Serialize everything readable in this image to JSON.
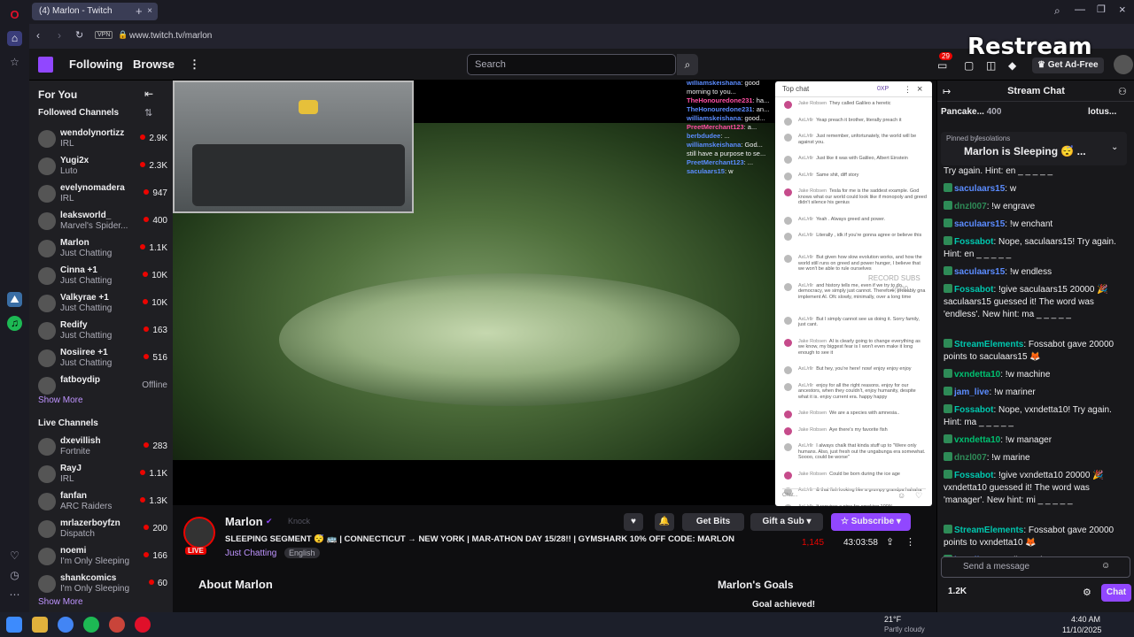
{
  "browser": {
    "tab_title": "(4) Marlon - Twitch",
    "url": "www.twitch.tv/marlon",
    "vpn_label": "VPN"
  },
  "restream_watermark": "Restream",
  "twitch_nav": {
    "following": "Following",
    "browse": "Browse",
    "search_placeholder": "Search",
    "notifications_count": "29",
    "get_ad_free": "Get Ad-Free"
  },
  "sidebar": {
    "for_you": "For You",
    "followed_title": "Followed Channels",
    "followed": [
      {
        "name": "wendolynortizz",
        "category": "IRL",
        "viewers": "2.9K"
      },
      {
        "name": "Yugi2x",
        "category": "Luto",
        "viewers": "2.3K"
      },
      {
        "name": "evelynomadera",
        "category": "IRL",
        "viewers": "947"
      },
      {
        "name": "leaksworld_",
        "category": "Marvel's Spider...",
        "viewers": "400"
      },
      {
        "name": "Marlon",
        "category": "Just Chatting",
        "viewers": "1.1K"
      },
      {
        "name": "Cinna +1",
        "category": "Just Chatting",
        "viewers": "10K"
      },
      {
        "name": "Valkyrae +1",
        "category": "Just Chatting",
        "viewers": "10K"
      },
      {
        "name": "Redify",
        "category": "Just Chatting",
        "viewers": "163"
      },
      {
        "name": "Nosiiree +1",
        "category": "Just Chatting",
        "viewers": "516"
      },
      {
        "name": "fatboydip",
        "category": "",
        "viewers": "Offline"
      }
    ],
    "show_more": "Show More",
    "live_title": "Live Channels",
    "live": [
      {
        "name": "dxevillish",
        "category": "Fortnite",
        "viewers": "283"
      },
      {
        "name": "RayJ",
        "category": "IRL",
        "viewers": "1.1K"
      },
      {
        "name": "fanfan",
        "category": "ARC Raiders",
        "viewers": "1.3K"
      },
      {
        "name": "mrlazerboyfzn",
        "category": "Dispatch",
        "viewers": "200"
      },
      {
        "name": "noemi",
        "category": "I'm Only Sleeping",
        "viewers": "166"
      },
      {
        "name": "shankcomics",
        "category": "I'm Only Sleeping",
        "viewers": "60"
      }
    ],
    "show_more_2": "Show More",
    "overlay_text": "dd"
  },
  "overlay_chat": [
    {
      "user": "williamskeishana",
      "text": ": good morning to you..."
    },
    {
      "user": "TheHonouredone231",
      "text": ": ha..."
    },
    {
      "user": "TheHonouredone231",
      "text": ": an..."
    },
    {
      "user": "williamskeishana",
      "text": ": good..."
    },
    {
      "user": "PreetMerchant123",
      "text": ": a..."
    },
    {
      "user": "berbdudee",
      "text": ": ..."
    },
    {
      "user": "williamskeishana",
      "text": ": God..."
    },
    {
      "user": "",
      "text": "still have a purpose to se..."
    },
    {
      "user": "PreetMerchant123",
      "text": ": ..."
    },
    {
      "user": "saculaars15",
      "text": ": w"
    }
  ],
  "popup_chat": {
    "header": "Top chat",
    "points": "0XP",
    "watermark": "RECORD SUBS",
    "watermark_sub": "2/500",
    "input_placeholder": "Chat...",
    "messages": [
      {
        "user": "Jake Robsen",
        "text": "They called Galileo a heretic"
      },
      {
        "user": "AxL/rllr",
        "text": "Yeap preach it brother, literally preach it"
      },
      {
        "user": "AxL/rllr",
        "text": "Just remember, unfortunately, the world will be against you."
      },
      {
        "user": "AxL/rllr",
        "text": "Just like it was with Galileo, Albert Einstein"
      },
      {
        "user": "AxL/rllr",
        "text": "Same shit, diff story"
      },
      {
        "user": "Jake Robsen",
        "text": "Tesla for me is the saddest example. God knows what our world could look like if monopoly and greed didn't silence his genius"
      },
      {
        "user": "AxL/rllr",
        "text": "Yeah . Always greed and power."
      },
      {
        "user": "AxL/rllr",
        "text": "Literally , idk if you're gonna agree or believe this"
      },
      {
        "user": "AxL/rllr",
        "text": "But given how slow evolution works, and how the world still runs on greed and power hunger, I believe that we won't be able to rule ourselves"
      },
      {
        "user": "AxL/rllr",
        "text": "and history tells me, even if we try to do democracy, we simply just cannot. Therefore, probably gna implement AI. Ofc slowly, minimally, over a long time"
      },
      {
        "user": "AxL/rllr",
        "text": "But I simply cannot see us doing it. Sorry family, just cant."
      },
      {
        "user": "Jake Robsen",
        "text": "AI is clearly going to change everything as we know, my biggest fear is I won't even make it long enough to see it"
      },
      {
        "user": "AxL/rllr",
        "text": "But hey, you're here! now! enjoy enjoy enjoy"
      },
      {
        "user": "AxL/rllr",
        "text": "enjoy for all the right reasons. enjoy for our ancestors, when they couldn't, enjoy humanity, despite what it is. enjoy current era. happy happy"
      },
      {
        "user": "Jake Robsen",
        "text": "We are a species with amnesia.."
      },
      {
        "user": "Jake Robsen",
        "text": "Aye there's my favorite fish"
      },
      {
        "user": "AxL/rllr",
        "text": "I always chalk that kinda stuff up to \"Were only humans. Also, just fresh out the ungabunga era somewhat. Soooo, could be worse\""
      },
      {
        "user": "Jake Robsen",
        "text": "Could be born during the ice age"
      },
      {
        "user": "AxL/rllr",
        "text": "& that fish looking like a grumpy grandpa hahaha"
      },
      {
        "user": "AxL/rllr",
        "text": "It requires a pipe for smoking 100%"
      },
      {
        "user": "leg over",
        "text": "how old yall think these are"
      },
      {
        "user": "AxL/rllr",
        "text": "1 of those old pipes"
      },
      {
        "user": "leg over",
        "text": "oh 100%"
      },
      {
        "user": "AxL/rllr",
        "text": "Old as in fish age or what exactly"
      }
    ]
  },
  "stream_info": {
    "channel": "Marlon",
    "knock": "Knock",
    "title": "SLEEPING SEGMENT 😴 🚌 | CONNECTICUT → NEW YORK | MAR-ATHON DAY 15/28!! | GYMSHARK 10% OFF CODE: MARLON",
    "category": "Just Chatting",
    "tag": "English",
    "live_label": "LIVE",
    "viewers": "1,145",
    "uptime": "43:03:58",
    "get_bits": "Get Bits",
    "gift_sub": "Gift a Sub",
    "subscribe": "Subscribe",
    "about": "About Marlon",
    "goals_title": "Marlon's Goals",
    "goal_text": "Goal achieved!"
  },
  "chat": {
    "header": "Stream Chat",
    "top_bar_1_name": "Pancake...",
    "top_bar_1_val": "400",
    "top_bar_2_name": "lotus...",
    "pinned_by_label": "Pinned by",
    "pinned_by_user": "fesolations",
    "pinned_text": "Marlon is Sleeping 😴 ...",
    "input_placeholder": "Send a message",
    "points": "1.2K",
    "chat_button": "Chat",
    "messages": [
      {
        "user": "",
        "text": "Try again. Hint: en _ _ _ _ _",
        "color": "#efeff1"
      },
      {
        "user": "saculaars15",
        "text": ": w",
        "color": "#5b8cff"
      },
      {
        "user": "dnzl007",
        "text": ": !w engrave",
        "color": "#2e8b57"
      },
      {
        "user": "saculaars15",
        "text": ": !w enchant",
        "color": "#5b8cff"
      },
      {
        "user": "Fossabot",
        "text": ": Nope, saculaars15! Try again. Hint: en _ _ _ _ _",
        "color": "#00c8af"
      },
      {
        "user": "saculaars15",
        "text": ": !w endless",
        "color": "#5b8cff"
      },
      {
        "user": "Fossabot",
        "text": ": !give saculaars15 20000 🎉 saculaars15 guessed it! The word was 'endless'. New hint: ma _ _ _ _ _",
        "color": "#00c8af"
      },
      {
        "user": "StreamElements",
        "text": ": Fossabot gave 20000 points to saculaars15 🦊",
        "color": "#00c8af"
      },
      {
        "user": "vxndetta10",
        "text": ": !w machine",
        "color": "#00c070"
      },
      {
        "user": "jam_live",
        "text": ": !w mariner",
        "color": "#5b8cff"
      },
      {
        "user": "Fossabot",
        "text": ": Nope, vxndetta10! Try again. Hint: ma _ _ _ _ _",
        "color": "#00c8af"
      },
      {
        "user": "vxndetta10",
        "text": ": !w manager",
        "color": "#00c070"
      },
      {
        "user": "dnzl007",
        "text": ": !w marine",
        "color": "#2e8b57"
      },
      {
        "user": "Fossabot",
        "text": ": !give vxndetta10 20000 🎉 vxndetta10 guessed it! The word was 'manager'. New hint: mi _ _ _ _ _",
        "color": "#00c8af"
      },
      {
        "user": "StreamElements",
        "text": ": Fossabot gave 20000 points to vxndetta10 🦊",
        "color": "#00c8af"
      },
      {
        "user": "jam_live",
        "text": ": !wordle mariner",
        "color": "#5b8cff"
      }
    ]
  },
  "taskbar": {
    "weather_temp": "21°F",
    "weather_desc": "Partly cloudy",
    "time": "4:40 AM",
    "date": "11/10/2025"
  },
  "colors": {
    "twitch_purple": "#9147ff",
    "live_red": "#eb0400",
    "opera_red": "#e0102a"
  }
}
